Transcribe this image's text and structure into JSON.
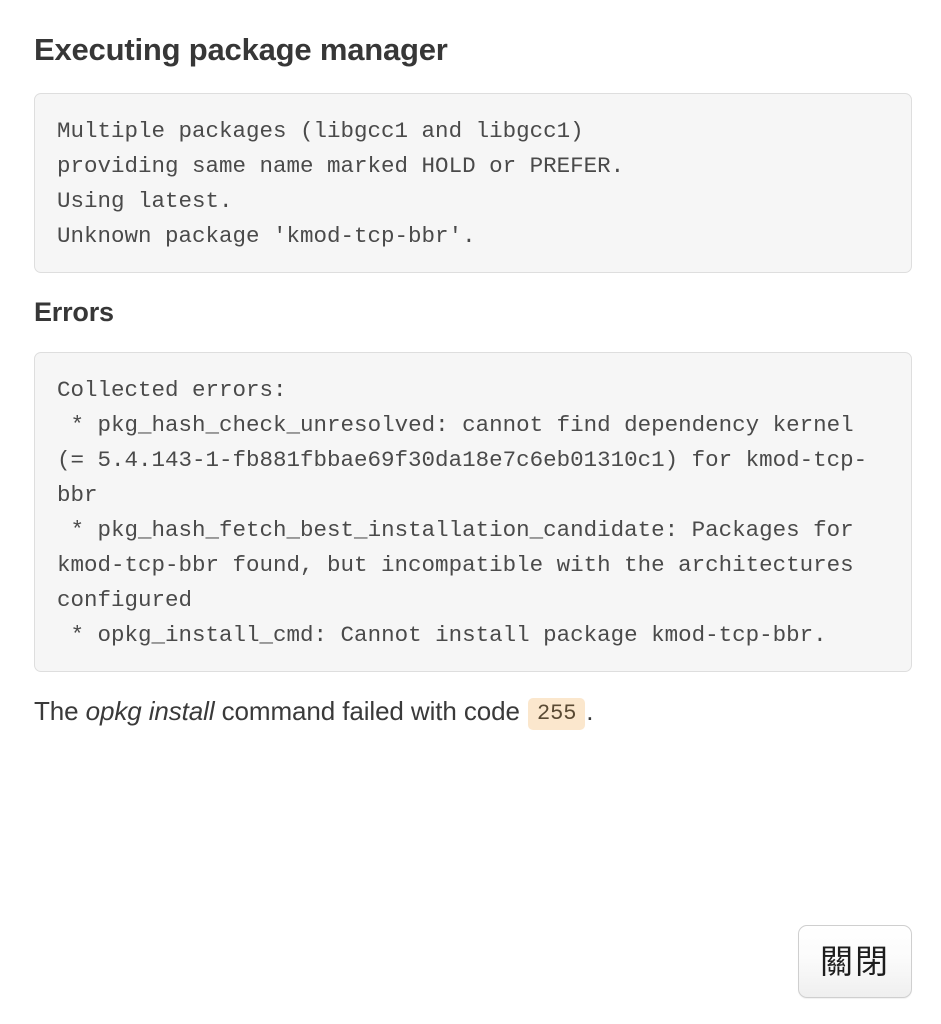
{
  "page": {
    "title": "Executing package manager",
    "background_color": "#ffffff"
  },
  "output_block": {
    "label": "package-manager-output",
    "background_color": "#f6f6f6",
    "border_color": "#dedede",
    "lines": [
      "Multiple packages (libgcc1 and libgcc1)",
      "providing same name marked HOLD or PREFER.",
      "Using latest.",
      "Unknown package 'kmod-tcp-bbr'."
    ],
    "text": "Multiple packages (libgcc1 and libgcc1) providing same name marked HOLD or PREFER. Using latest.\nUnknown package 'kmod-tcp-bbr'."
  },
  "errors_section": {
    "heading": "Errors",
    "block": {
      "background_color": "#f6f6f6",
      "border_color": "#dedede",
      "lines": [
        "Collected errors:",
        " * pkg_hash_check_unresolved: cannot find dependency kernel (= 5.4.143-1-fb881fbbae69f30da18e7c6eb01310c1) for kmod-tcp-bbr",
        " * pkg_hash_fetch_best_installation_candidate: Packages for kmod-tcp-bbr found, but incompatible with the architectures configured",
        " * opkg_install_cmd: Cannot install package kmod-tcp-bbr."
      ],
      "dependency_version": "5.4.143-1-fb881fbbae69f30da18e7c6eb01310c1",
      "package_name": "kmod-tcp-bbr"
    }
  },
  "status": {
    "prefix": "The ",
    "command": "opkg install",
    "middle": " command failed with code ",
    "exit_code": "255",
    "suffix": ".",
    "badge_color": "#fbe7cd"
  },
  "actions": {
    "close_label": "關閉"
  }
}
